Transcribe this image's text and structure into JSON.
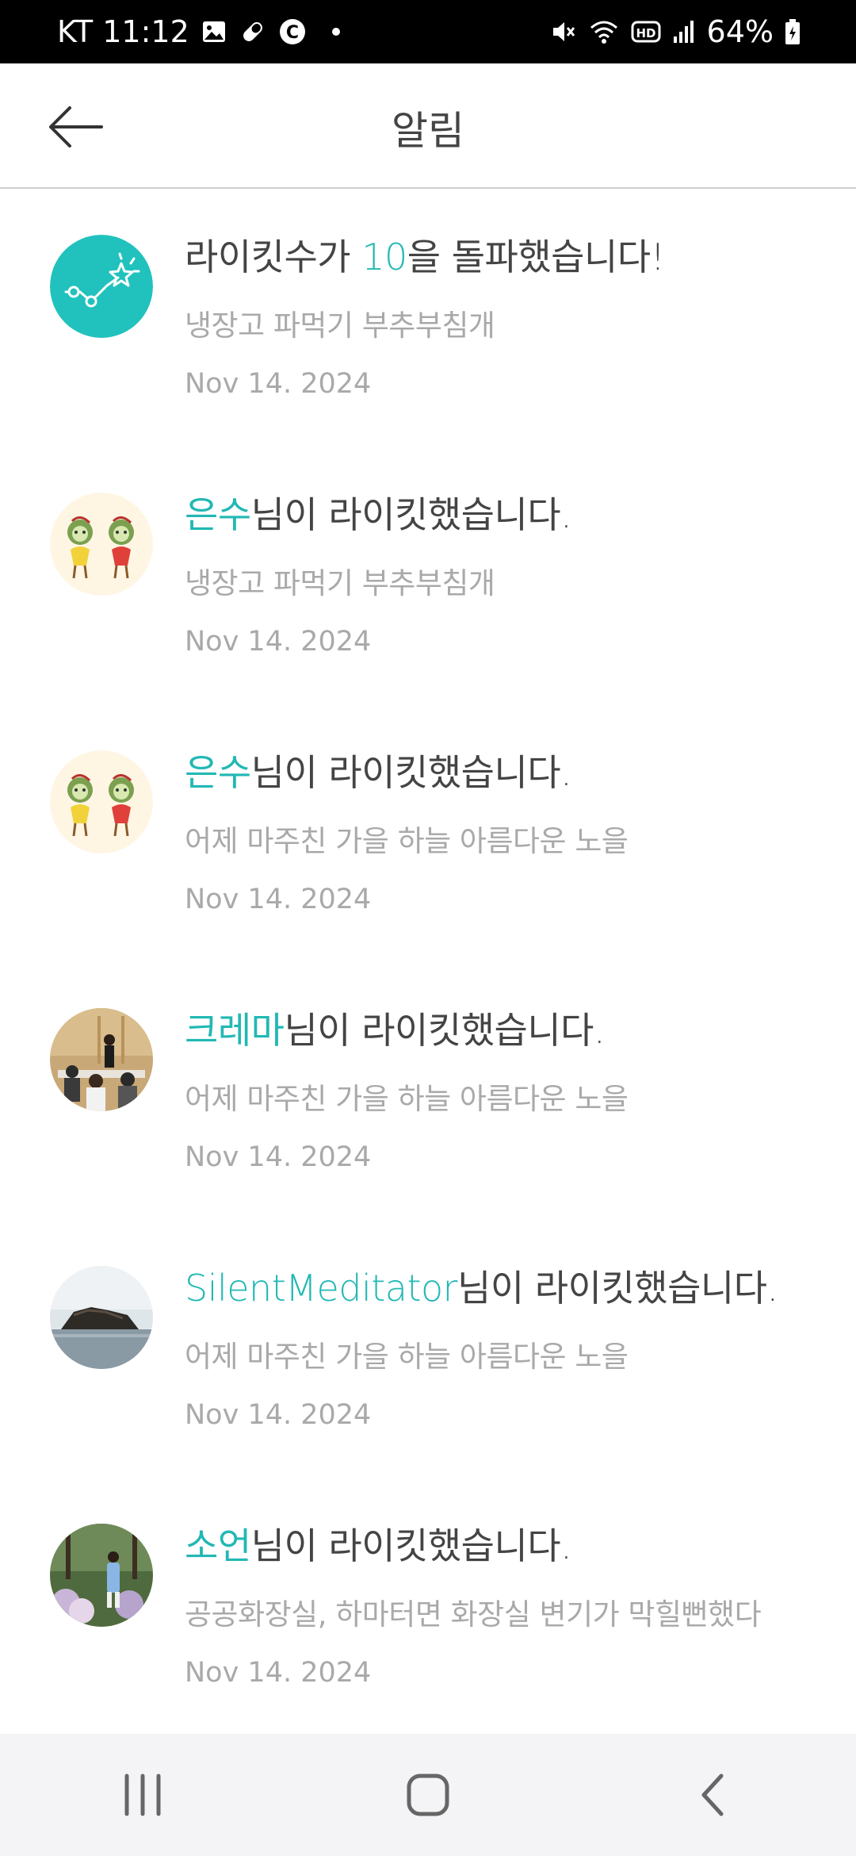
{
  "status_bar": {
    "carrier_time": "KT 11:12",
    "battery": "64%",
    "left_icons": [
      "image-icon",
      "pill-icon",
      "c-badge-icon",
      "dot-icon"
    ],
    "right_icons": [
      "mute-icon",
      "wifi-icon",
      "hd-icon",
      "signal-icon",
      "battery-icon"
    ]
  },
  "header": {
    "title": "알림",
    "back_icon": "arrow-left-icon"
  },
  "colors": {
    "accent": "#22b8b4",
    "primary_text": "#444444",
    "secondary_text": "#a9a9a9",
    "divider": "#cfcfcf"
  },
  "notifications": [
    {
      "avatar": "milestone-chart-icon",
      "pre": "라이킷수가 ",
      "highlight": "10",
      "post": "을 돌파했습니다!",
      "subtitle": "냉장고 파먹기 부추부침개",
      "date": "Nov 14. 2024"
    },
    {
      "avatar": "illustrated-two-characters",
      "pre": "",
      "highlight": "은수",
      "post": "님이 라이킷했습니다.",
      "subtitle": "냉장고 파먹기 부추부침개",
      "date": "Nov 14. 2024"
    },
    {
      "avatar": "illustrated-two-characters",
      "pre": "",
      "highlight": "은수",
      "post": "님이 라이킷했습니다.",
      "subtitle": "어제 마주친 가을 하늘 아름다운 노을",
      "date": "Nov 14. 2024"
    },
    {
      "avatar": "photo-presentation-room",
      "pre": "",
      "highlight": "크레마",
      "post": "님이 라이킷했습니다.",
      "subtitle": "어제 마주친 가을 하늘 아름다운 노을",
      "date": "Nov 14. 2024"
    },
    {
      "avatar": "photo-rock-island-sea",
      "pre": "",
      "highlight": "SilentMeditator",
      "post": "님이 라이킷했습니다.",
      "subtitle": "어제 마주친 가을 하늘 아름다운 노을",
      "date": "Nov 14. 2024"
    },
    {
      "avatar": "photo-person-in-garden",
      "pre": "",
      "highlight": "소언",
      "post": "님이 라이킷했습니다.",
      "subtitle": "공공화장실, 하마터면 화장실 변기가 막힐뻔했다",
      "date": "Nov 14. 2024"
    }
  ],
  "nav_bar": {
    "buttons": [
      "recent-apps-icon",
      "home-icon",
      "back-icon"
    ]
  }
}
